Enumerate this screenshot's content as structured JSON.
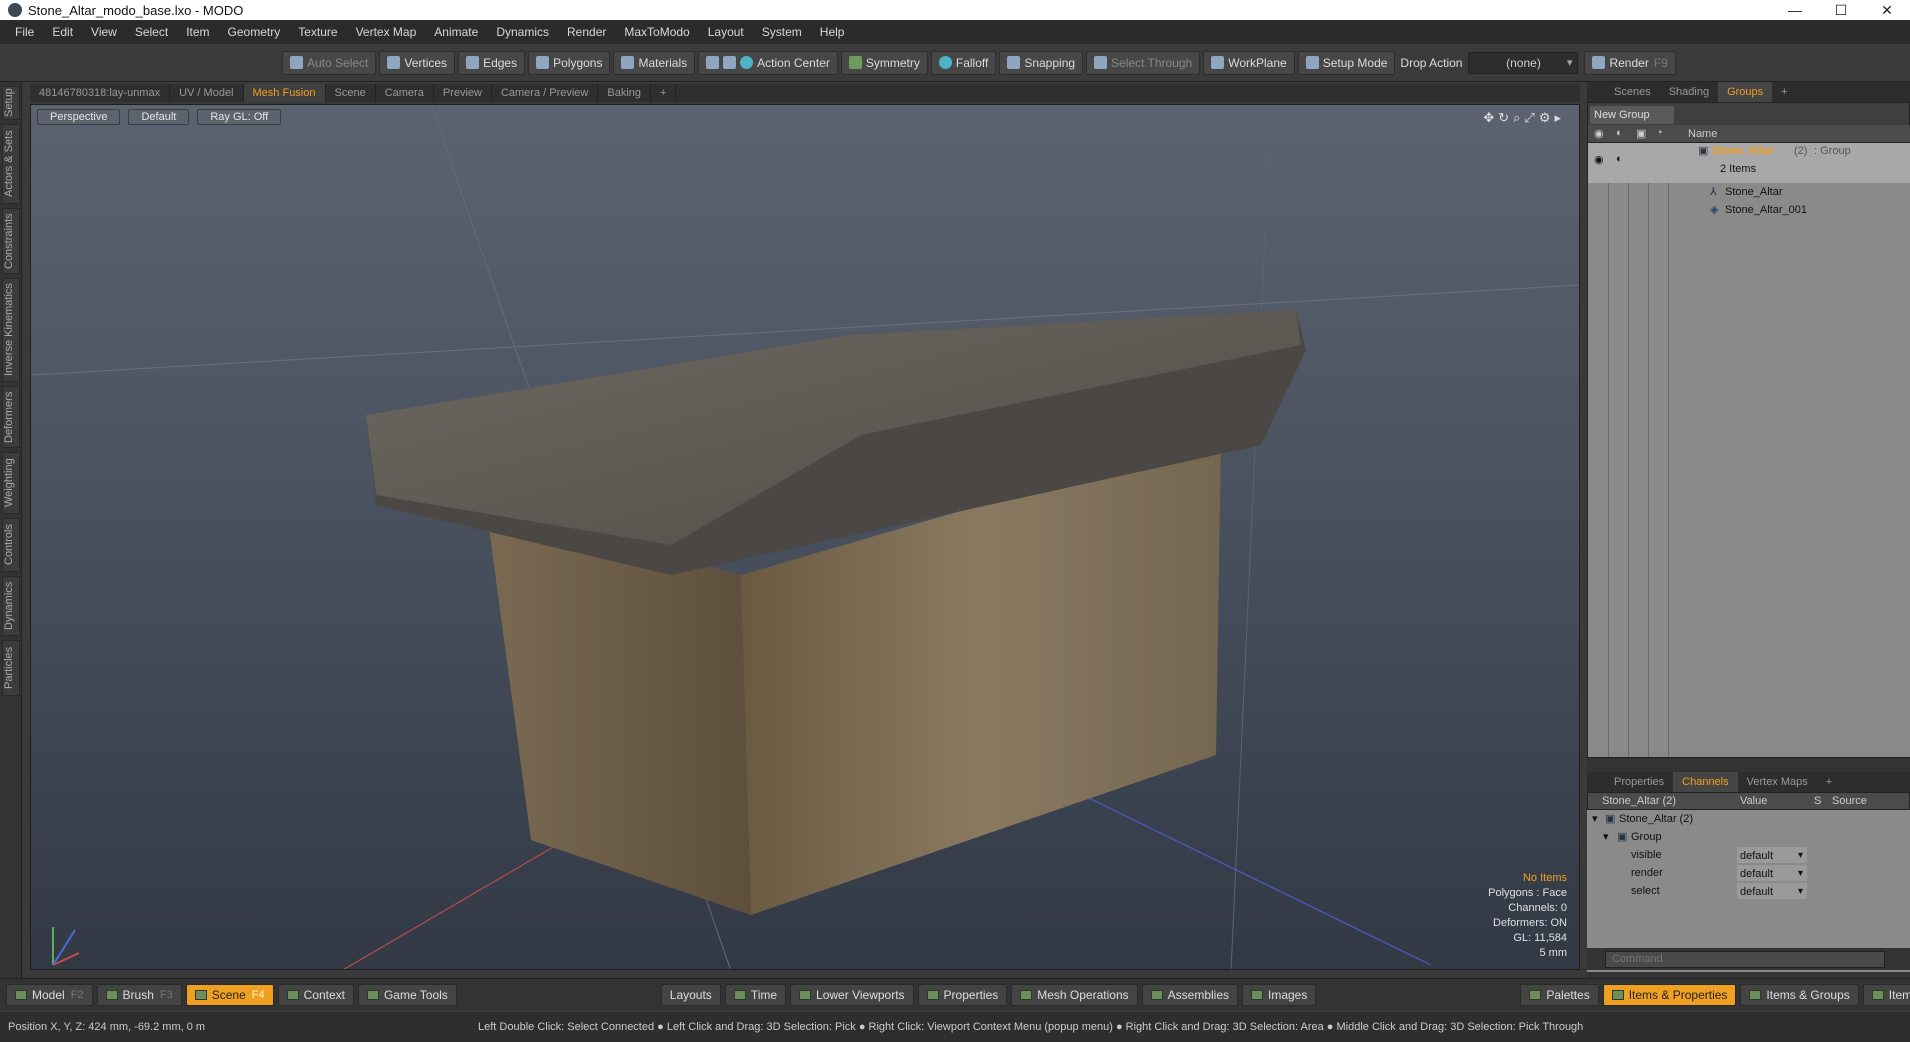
{
  "window": {
    "title": "Stone_Altar_modo_base.lxo - MODO"
  },
  "menu": [
    "File",
    "Edit",
    "View",
    "Select",
    "Item",
    "Geometry",
    "Texture",
    "Vertex Map",
    "Animate",
    "Dynamics",
    "Render",
    "MaxToModo",
    "Layout",
    "System",
    "Help"
  ],
  "toolbar": {
    "auto_select": "Auto Select",
    "vertices": "Vertices",
    "edges": "Edges",
    "polygons": "Polygons",
    "materials": "Materials",
    "action_center": "Action Center",
    "symmetry": "Symmetry",
    "falloff": "Falloff",
    "snapping": "Snapping",
    "select_through": "Select Through",
    "workplane": "WorkPlane",
    "setup_mode": "Setup Mode",
    "drop_action": "Drop Action",
    "drop_value": "(none)",
    "render": "Render",
    "render_key": "F9"
  },
  "left_tabs": [
    "Setup",
    "Actors & Sets",
    "Constraints",
    "Inverse Kinematics",
    "Deformers",
    "Weighting",
    "Controls",
    "Dynamics",
    "Particles"
  ],
  "viewport_tabs": [
    "48146780318:lay-unmax",
    "UV / Model",
    "Mesh Fusion",
    "Scene",
    "Camera",
    "Preview",
    "Camera / Preview",
    "Baking",
    "+"
  ],
  "viewport": {
    "view": "Perspective",
    "shading": "Default",
    "raygl": "Ray GL: Off"
  },
  "info": {
    "items": "No Items",
    "polygons": "Polygons : Face",
    "channels": "Channels: 0",
    "deformers": "Deformers: ON",
    "gl": "GL: 11,584",
    "scale": "5 mm"
  },
  "right_tabs": [
    "Scenes",
    "Shading",
    "Groups",
    "+"
  ],
  "groups": {
    "new_group": "New Group",
    "name_col": "Name",
    "group_name": "Stone_Altar",
    "group_count": "(2)",
    "group_type": ": Group",
    "item_count": "2 Items",
    "items": [
      "Stone_Altar",
      "Stone_Altar_001"
    ]
  },
  "channel_tabs": [
    "Properties",
    "Channels",
    "Vertex Maps",
    "+"
  ],
  "channels": {
    "header": "Stone_Altar (2)",
    "value_col": "Value",
    "s_col": "S",
    "source_col": "Source",
    "root": "Stone_Altar (2)",
    "group": "Group",
    "rows": [
      {
        "name": "visible",
        "value": "default"
      },
      {
        "name": "render",
        "value": "default"
      },
      {
        "name": "select",
        "value": "default"
      }
    ]
  },
  "command_placeholder": "Command",
  "bottom": {
    "model": "Model",
    "model_key": "F2",
    "brush": "Brush",
    "brush_key": "F3",
    "scene": "Scene",
    "scene_key": "F4",
    "context": "Context",
    "game_tools": "Game Tools",
    "layouts": "Layouts",
    "time": "Time",
    "lower_viewports": "Lower Viewports",
    "properties": "Properties",
    "mesh_ops": "Mesh Operations",
    "assemblies": "Assemblies",
    "images": "Images",
    "palettes": "Palettes",
    "items_props": "Items & Properties",
    "items_groups": "Items & Groups",
    "items_shading": "Items & Shading"
  },
  "status": {
    "position": "Position X, Y, Z:  424 mm, -69.2 mm, 0 m",
    "hints": "Left Double Click: Select Connected ● Left Click and Drag: 3D Selection: Pick ● Right Click: Viewport Context Menu (popup menu) ● Right Click and Drag: 3D Selection: Area ● Middle Click and Drag: 3D Selection: Pick Through"
  },
  "colors": {
    "accent": "#f0a020"
  }
}
